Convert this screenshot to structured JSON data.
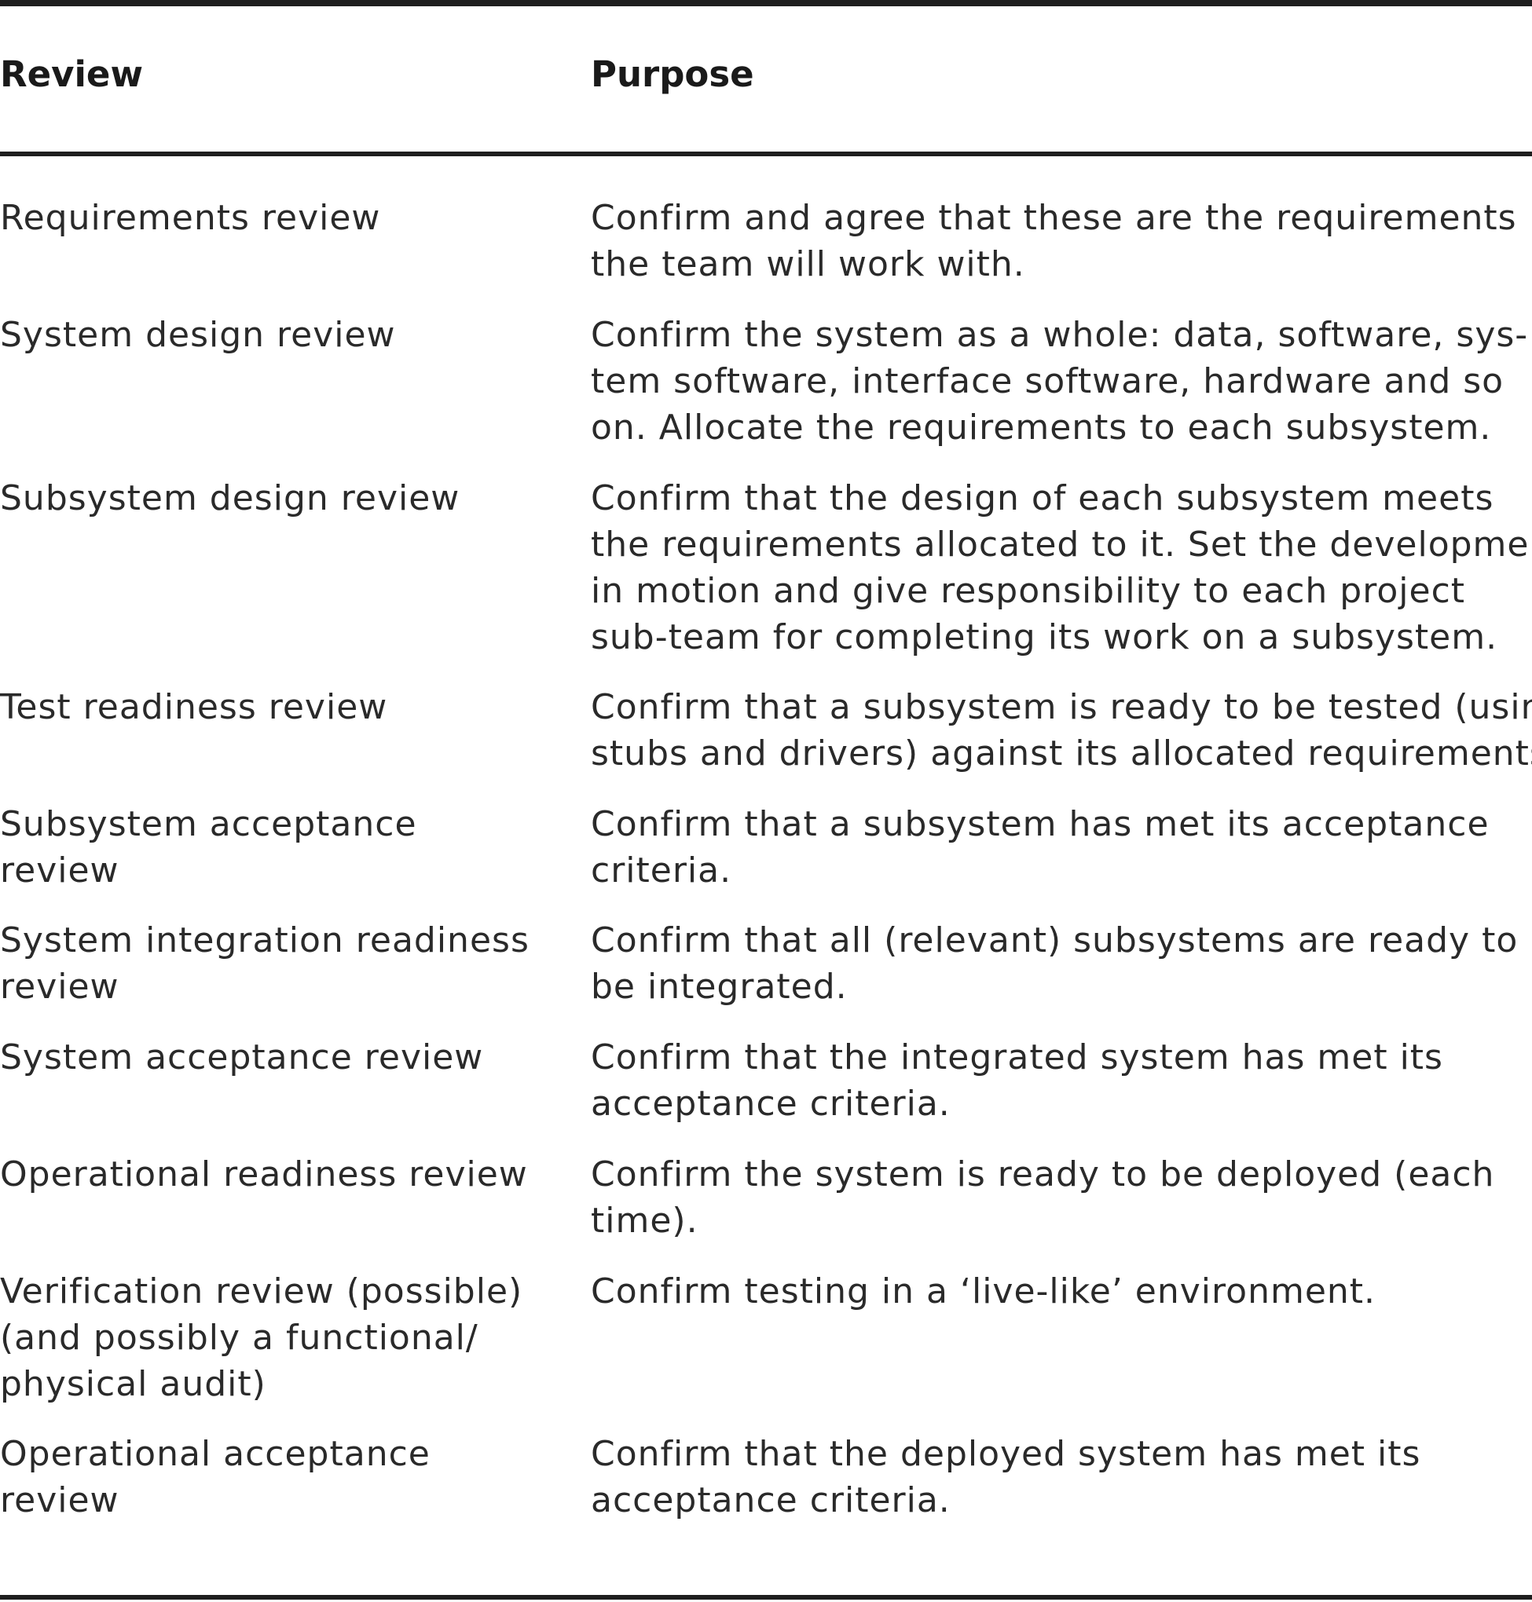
{
  "table": {
    "headers": {
      "review": "Review",
      "purpose": "Purpose"
    },
    "rows": [
      {
        "review": [
          "Requirements review"
        ],
        "purpose": [
          "Confirm and agree that these are the requirements",
          "the team will work with."
        ]
      },
      {
        "review": [
          "System design review"
        ],
        "purpose": [
          "Confirm the system as a whole: data, software, sys-",
          "tem software, interface software, hardware and so",
          "on. Allocate the requirements to each subsystem."
        ]
      },
      {
        "review": [
          "Subsystem design review"
        ],
        "purpose": [
          "Confirm that the design of each subsystem meets",
          "the requirements allocated to it. Set the development",
          "in motion and give responsibility to each project",
          "sub-team for completing its work on a subsystem."
        ]
      },
      {
        "review": [
          "Test readiness review"
        ],
        "purpose": [
          "Confirm that a subsystem is ready to be tested (using",
          "stubs and drivers) against its allocated requirements."
        ]
      },
      {
        "review": [
          "Subsystem acceptance",
          "review"
        ],
        "purpose": [
          "Confirm that a subsystem has met its acceptance",
          "criteria."
        ]
      },
      {
        "review": [
          "System integration readiness",
          "review"
        ],
        "purpose": [
          "Confirm that all (relevant) subsystems are ready to",
          "be integrated."
        ]
      },
      {
        "review": [
          "System acceptance review"
        ],
        "purpose": [
          "Confirm that the integrated system has met its",
          "acceptance criteria."
        ]
      },
      {
        "review": [
          "Operational readiness review"
        ],
        "purpose": [
          "Confirm the system is ready to be deployed (each",
          "time)."
        ]
      },
      {
        "review": [
          "Verification review (possible)",
          "(and possibly a functional/",
          "physical audit)"
        ],
        "purpose": [
          "Confirm testing in a ‘live-like’ environment."
        ]
      },
      {
        "review": [
          "Operational acceptance",
          "review"
        ],
        "purpose": [
          "Confirm that the deployed system has met its",
          "acceptance criteria."
        ]
      }
    ]
  }
}
